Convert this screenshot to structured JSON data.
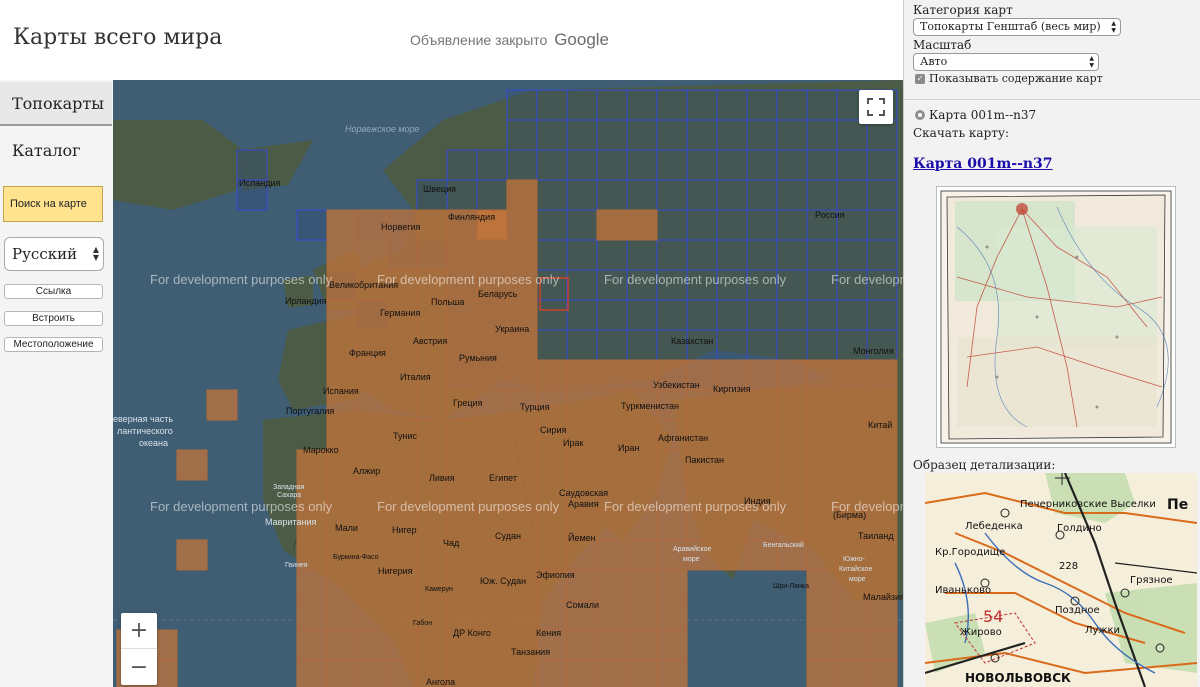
{
  "header": {
    "site_title": "Карты всего мира",
    "ad_closed_text": "Объявление закрыто",
    "ad_brand": "Google"
  },
  "sidebar": {
    "tabs": [
      {
        "label": "Топокарты",
        "active": true
      },
      {
        "label": "Каталог",
        "active": false
      }
    ],
    "search_button": "Поиск на карте",
    "language": "Русский",
    "buttons": [
      "Ссылка",
      "Встроить",
      "Местоположение"
    ]
  },
  "map": {
    "watermark": "For development purposes only",
    "labels": {
      "norwegian_sea": "Норвежское море",
      "iceland": "Исландия",
      "sweden": "Швеция",
      "finland": "Финляндия",
      "norway": "Норвегия",
      "russia": "Россия",
      "ireland": "Ирландия",
      "great_britain": "Великобритания",
      "poland": "Польша",
      "belarus": "Беларусь",
      "germany": "Германия",
      "ukraine": "Украина",
      "austria": "Австрия",
      "france": "Франция",
      "romania": "Румыния",
      "kazakhstan": "Казахстан",
      "mongolia": "Монголия",
      "italy": "Италия",
      "uzbekistan": "Узбекистан",
      "kyrgyzstan": "Киргизия",
      "spain": "Испания",
      "portugal": "Португалия",
      "greece": "Греция",
      "turkey": "Турция",
      "turkmenistan": "Туркменистан",
      "atlantic_1": "еверная часть",
      "atlantic_2": "лантического",
      "atlantic_3": "океана",
      "tunisia": "Тунис",
      "syria": "Сирия",
      "iraq": "Ирак",
      "afghanistan": "Афганистан",
      "china": "Китай",
      "morocco": "Марокко",
      "iran": "Иран",
      "pakistan": "Пакистан",
      "algeria": "Алжир",
      "libya": "Ливия",
      "egypt": "Египет",
      "western_sahara_1": "Западная",
      "western_sahara_2": "Сахара",
      "saudi_arabia_1": "Саудовская",
      "saudi_arabia_2": "Аравия",
      "india": "Индия",
      "myanmar": "(Бирма)",
      "mauritania": "Мавритания",
      "mali": "Мали",
      "niger": "Нигер",
      "chad": "Чад",
      "sudan": "Судан",
      "yemen": "Йемен",
      "arabian_sea_1": "Аравийское",
      "arabian_sea_2": "море",
      "bay_bengal": "Бенгальский",
      "thailand": "Таиланд",
      "burkina": "Буркина-Фасо",
      "guinea": "Гвинея",
      "nigeria": "Нигерия",
      "cameroon": "Камерун",
      "south_sudan": "Юж. Судан",
      "ethiopia": "Эфиопия",
      "somalia": "Сомали",
      "south_china_1": "Южно-",
      "south_china_2": "Китайское",
      "south_china_3": "море",
      "sri_lanka": "Шри-Ланка",
      "gabon": "Габон",
      "dr_congo": "ДР Конго",
      "kenya": "Кения",
      "malaysia": "Малайзия",
      "tanzania": "Танзания",
      "angola": "Ангола"
    }
  },
  "panel": {
    "category_label": "Категория карт",
    "category_value": "Топокарты Генштаб (весь мир)",
    "scale_label": "Масштаб",
    "scale_value": "Авто",
    "show_contents": "Показывать содержание карт",
    "map_item": "Карта 001m--n37",
    "download_label": "Скачать карту:",
    "download_link": "Карта 001m--n37",
    "detail_label": "Образец детализации:",
    "detail_texts": {
      "village_1": "Печерниковские Выселки",
      "village_2": "Лебеденка",
      "village_3": "Голдино",
      "village_4": "Кр.Городище",
      "village_5": "Грязное",
      "village_6": "Иваньково",
      "village_7": "Поздное",
      "village_8": "Жирово",
      "village_9": "Лужки",
      "town": "НОВОЛЬВОВСК",
      "mark_pe": "Пе",
      "num_228": "228",
      "num_54": "54"
    }
  },
  "colors": {
    "sea": "#3f5d73",
    "land": "#4b5a42",
    "tile_orange": "#c8763a",
    "tile_blue_border": "#2d43d6",
    "selected_tile": "#e04020",
    "link": "#1a0dab",
    "search_bg": "#ffe38f"
  },
  "icons": {
    "fullscreen": "fullscreen-icon",
    "zoom_in": "plus-icon",
    "zoom_out": "minus-icon"
  }
}
